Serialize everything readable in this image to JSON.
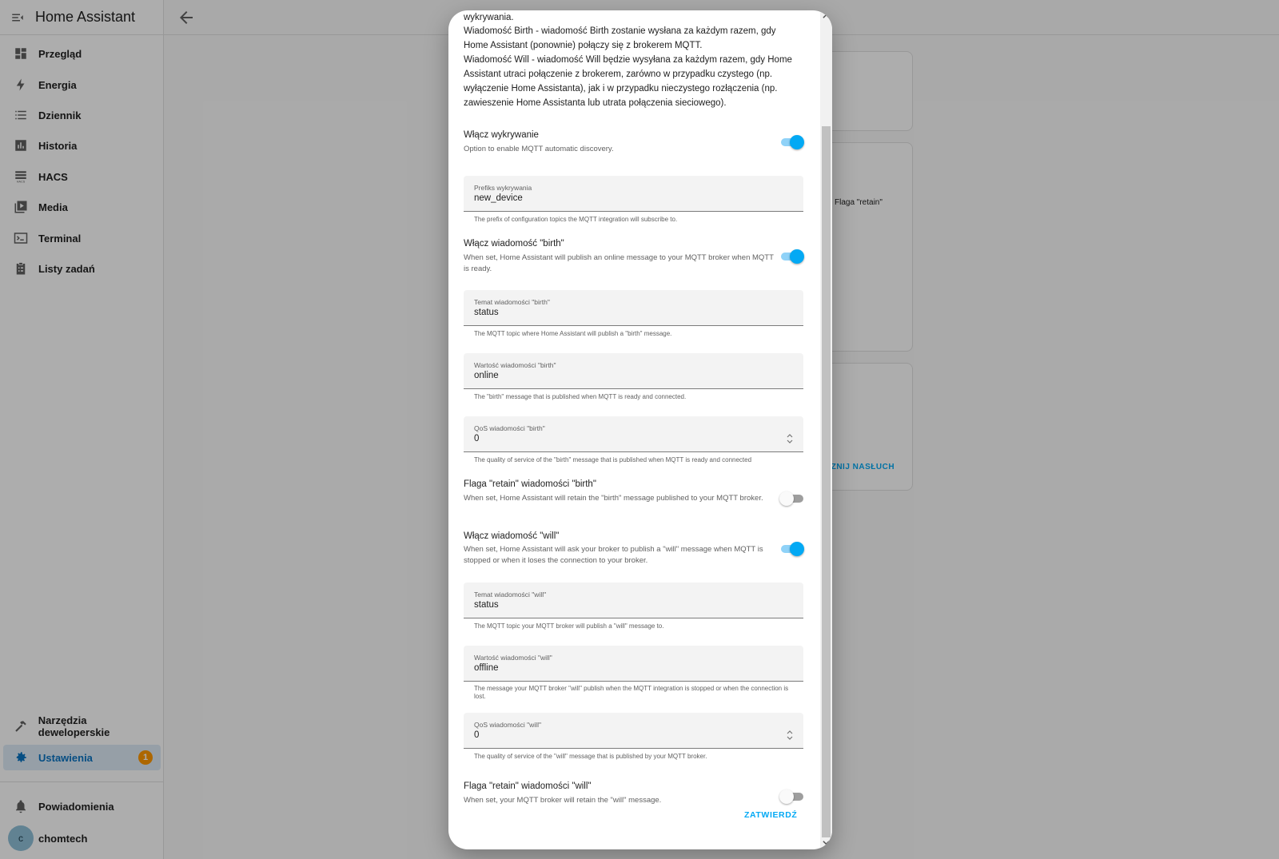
{
  "app": {
    "title": "Home Assistant"
  },
  "sidebar": {
    "items": [
      {
        "label": "Przegląd"
      },
      {
        "label": "Energia"
      },
      {
        "label": "Dziennik"
      },
      {
        "label": "Historia"
      },
      {
        "label": "HACS"
      },
      {
        "label": "Media"
      },
      {
        "label": "Terminal"
      },
      {
        "label": "Listy zadań"
      }
    ],
    "dev_tools": {
      "label": "Narzędzia deweloperskie"
    },
    "settings": {
      "label": "Ustawienia",
      "badge": "1"
    },
    "notifications": {
      "label": "Powiadomienia"
    },
    "user": {
      "initial": "c",
      "name": "chomtech"
    }
  },
  "background": {
    "retain_label": "Flaga \"retain\"",
    "listen_button": "CZNIJ NASŁUCH"
  },
  "dialog": {
    "intro": [
      "wykrywania.",
      "Wiadomość Birth - wiadomość Birth zostanie wysłana za każdym razem, gdy Home Assistant (ponownie) połączy się z brokerem MQTT.",
      "Wiadomość Will - wiadomość Will będzie wysyłana za każdym razem, gdy Home Assistant utraci połączenie z brokerem, zarówno w przypadku czystego (np. wyłączenie Home Assistanta), jak i w przypadku nieczystego rozłączenia (np. zawieszenie Home Assistanta lub utrata połączenia sieciowego)."
    ],
    "discovery": {
      "title": "Włącz wykrywanie",
      "desc": "Option to enable MQTT automatic discovery.",
      "on": true
    },
    "discovery_prefix": {
      "label": "Prefiks wykrywania",
      "value": "new_device",
      "helper": "The prefix of configuration topics the MQTT integration will subscribe to."
    },
    "birth": {
      "title": "Włącz wiadomość \"birth\"",
      "desc": "When set, Home Assistant will publish an online message to your MQTT broker when MQTT is ready.",
      "on": true
    },
    "birth_topic": {
      "label": "Temat wiadomości \"birth\"",
      "value": "status",
      "helper": "The MQTT topic where Home Assistant will publish a \"birth\" message."
    },
    "birth_payload": {
      "label": "Wartość wiadomości \"birth\"",
      "value": "online",
      "helper": "The \"birth\" message that is published when MQTT is ready and connected."
    },
    "birth_qos": {
      "label": "QoS wiadomości \"birth\"",
      "value": "0",
      "helper": "The quality of service of the \"birth\" message that is published when MQTT is ready and connected"
    },
    "birth_retain": {
      "title": "Flaga \"retain\" wiadomości \"birth\"",
      "desc": "When set, Home Assistant will retain the \"birth\" message published to your MQTT broker.",
      "on": false
    },
    "will": {
      "title": "Włącz wiadomość \"will\"",
      "desc": "When set, Home Assistant will ask your broker to publish a \"will\" message when MQTT is stopped or when it loses the connection to your broker.",
      "on": true
    },
    "will_topic": {
      "label": "Temat wiadomości \"will\"",
      "value": "status",
      "helper": "The MQTT topic your MQTT broker will publish a \"will\" message to."
    },
    "will_payload": {
      "label": "Wartość wiadomości \"will\"",
      "value": "offline",
      "helper": "The message your MQTT broker \"will\" publish when the MQTT integration is stopped or when the connection is lost."
    },
    "will_qos": {
      "label": "QoS wiadomości \"will\"",
      "value": "0",
      "helper": "The quality of service of the \"will\" message that is published by your MQTT broker."
    },
    "will_retain": {
      "title": "Flaga \"retain\" wiadomości \"will\"",
      "desc": "When set, your MQTT broker will retain the \"will\" message.",
      "on": false
    },
    "submit": "ZATWIERDŹ"
  }
}
